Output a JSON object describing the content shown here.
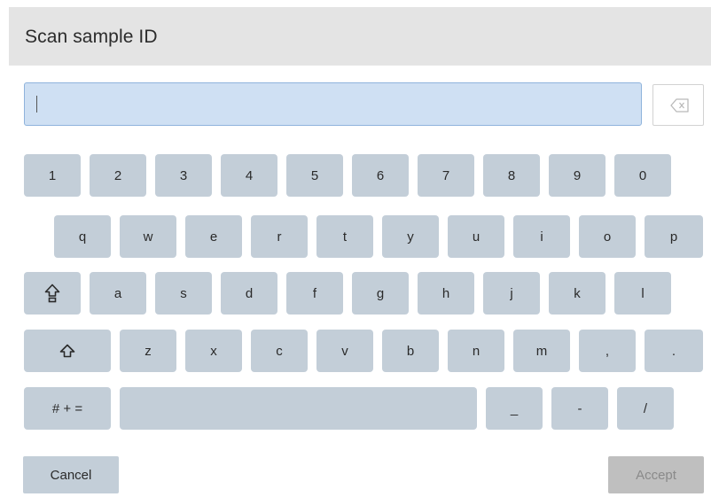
{
  "header": {
    "title": "Scan sample ID"
  },
  "input": {
    "value": ""
  },
  "keyboard": {
    "row1": [
      "1",
      "2",
      "3",
      "4",
      "5",
      "6",
      "7",
      "8",
      "9",
      "0"
    ],
    "row2": [
      "q",
      "w",
      "e",
      "r",
      "t",
      "y",
      "u",
      "i",
      "o",
      "p"
    ],
    "row3": [
      "a",
      "s",
      "d",
      "f",
      "g",
      "h",
      "j",
      "k",
      "l"
    ],
    "row4": [
      "z",
      "x",
      "c",
      "v",
      "b",
      "n",
      "m",
      ",",
      "."
    ],
    "row5": {
      "symbols_label": "# + =",
      "underscore": "_",
      "hyphen": "-",
      "slash": "/"
    }
  },
  "actions": {
    "cancel_label": "Cancel",
    "accept_label": "Accept"
  },
  "colors": {
    "key": "#c3ced8",
    "input_bg": "#cfe0f3",
    "title_bg": "#e4e4e4",
    "accept_disabled": "#bfbfbf"
  }
}
